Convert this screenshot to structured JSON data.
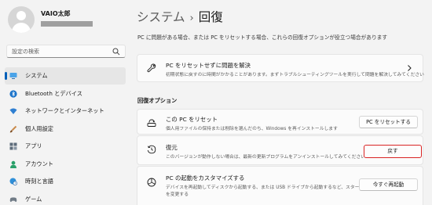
{
  "user": {
    "name": "VAIO太郎"
  },
  "search": {
    "placeholder": "設定の検索"
  },
  "nav": [
    {
      "label": "システム",
      "icon": "system-icon",
      "active": true
    },
    {
      "label": "Bluetooth とデバイス",
      "icon": "bluetooth-icon"
    },
    {
      "label": "ネットワークとインターネット",
      "icon": "wifi-icon"
    },
    {
      "label": "個人用設定",
      "icon": "paintbrush-icon"
    },
    {
      "label": "アプリ",
      "icon": "apps-icon"
    },
    {
      "label": "アカウント",
      "icon": "account-icon"
    },
    {
      "label": "時刻と言語",
      "icon": "globe-clock-icon"
    },
    {
      "label": "ゲーム",
      "icon": "gamepad-icon"
    }
  ],
  "breadcrumb": {
    "parent": "システム",
    "separator": "›",
    "current": "回復"
  },
  "description": "PC に問題がある場合、または PC をリセットする場合、これらの回復オプションが役立つ場合があります",
  "troubleshoot": {
    "title": "PC をリセットせずに問題を解決",
    "subtitle": "初期状態に戻すのに時間がかかることがあります。まずトラブルシューティングツールを実行して問題を解決してみてください"
  },
  "section_title": "回復オプション",
  "options": {
    "reset": {
      "title": "この PC をリセット",
      "subtitle": "個人用ファイルの保持または削除を選んだのち、Windows を再インストールします",
      "button": "PC をリセットする"
    },
    "goback": {
      "title": "復元",
      "subtitle": "このバージョンが動作しない場合は、最新の更新プログラムをアンインストールしてみてください",
      "button": "戻す"
    },
    "advanced": {
      "title": "PC の起動をカスタマイズする",
      "subtitle_line1": "デバイスを再起動してディスクから起動する、または USB ドライブから起動するなど、スタートアップ設定",
      "subtitle_line2": "を変更する",
      "button": "今すぐ再起動"
    }
  },
  "colors": {
    "accent": "#005fb8",
    "highlight_border": "#d92323"
  }
}
